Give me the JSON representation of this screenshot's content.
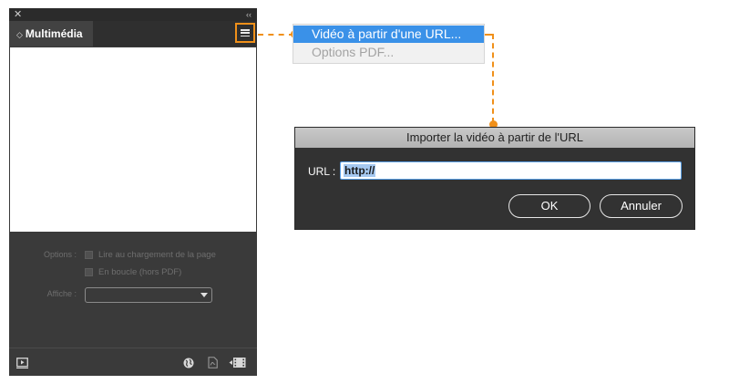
{
  "panel": {
    "close_glyph": "✕",
    "collapse_glyph": "‹‹",
    "tab_label": "Multimédia",
    "tab_arrows": "◇",
    "options": {
      "options_label": "Options :",
      "autoplay_label": "Lire au chargement de la page",
      "loop_label": "En boucle (hors PDF)",
      "poster_label": "Affiche :",
      "poster_value": ""
    },
    "footer_icons": [
      "preview-icon",
      "globe-icon",
      "pdf-icon",
      "place-video-icon"
    ]
  },
  "menu": {
    "items": [
      {
        "label": "Vidéo à partir d'une URL...",
        "state": "highlighted"
      },
      {
        "label": "Options PDF...",
        "state": "disabled"
      }
    ]
  },
  "dialog": {
    "title": "Importer la vidéo à partir de l'URL",
    "url_label": "URL :",
    "url_value": "http://",
    "ok_label": "OK",
    "cancel_label": "Annuler"
  },
  "colors": {
    "accent_orange": "#f0901a",
    "menu_highlight": "#3a91e8",
    "panel_bg": "#3a3a3a",
    "dialog_bg": "#323232"
  }
}
